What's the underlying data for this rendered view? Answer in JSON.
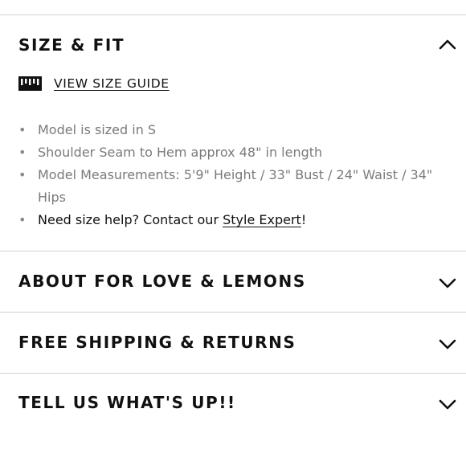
{
  "size_fit": {
    "title": "SIZE & FIT",
    "toggle_icon": "chevron-up-icon",
    "size_guide": {
      "icon": "ruler-icon",
      "label": "VIEW SIZE GUIDE"
    },
    "details": [
      "Model is sized in S",
      "Shoulder Seam to Hem approx 48\" in length",
      "Model Measurements: 5'9\" Height / 33\" Bust / 24\" Waist / 34\" Hips"
    ],
    "help": {
      "prefix": "Need size help? Contact our ",
      "link_label": "Style Expert",
      "suffix": "!"
    }
  },
  "accordions": [
    {
      "title": "ABOUT FOR LOVE & LEMONS",
      "icon": "chevron-down-icon"
    },
    {
      "title": "FREE SHIPPING & RETURNS",
      "icon": "chevron-down-icon"
    },
    {
      "title": "TELL US WHAT'S UP!!",
      "icon": "chevron-down-icon"
    }
  ],
  "colors": {
    "text": "#111111",
    "muted_text": "#7a7a7a",
    "divider": "#cfcfcf"
  }
}
